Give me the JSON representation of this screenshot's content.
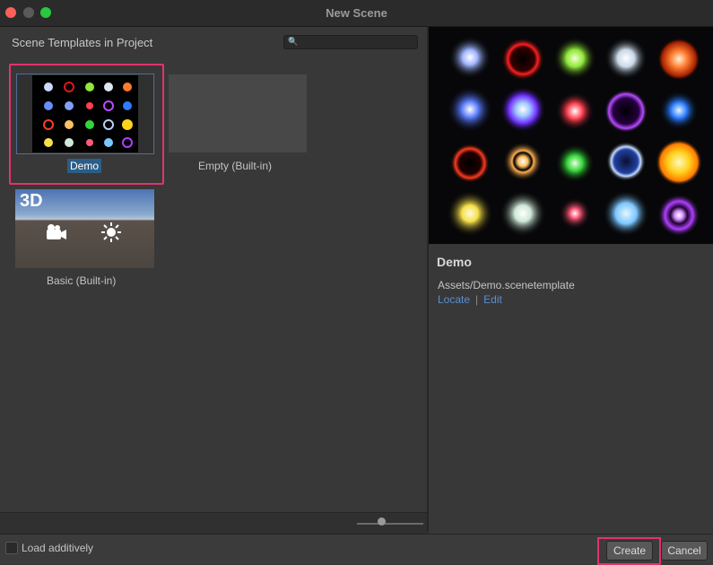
{
  "window": {
    "title": "New Scene"
  },
  "templates_panel": {
    "header": "Scene Templates in Project",
    "search": {
      "value": "",
      "placeholder": ""
    },
    "search_icon": "search-icon",
    "items": [
      {
        "label": "Demo",
        "selected": true
      },
      {
        "label": "Empty (Built-in)"
      },
      {
        "label": "Basic (Built-in)",
        "badge": "3D"
      }
    ]
  },
  "details": {
    "title": "Demo",
    "path": "Assets/Demo.scenetemplate",
    "locate_label": "Locate",
    "separator": "|",
    "edit_label": "Edit"
  },
  "footer": {
    "load_additively_label": "Load additively",
    "load_additively_checked": false,
    "create_label": "Create",
    "cancel_label": "Cancel"
  },
  "colors": {
    "highlight": "#e2336b",
    "selection": "#2c5d87",
    "link": "#5b8fd1"
  }
}
